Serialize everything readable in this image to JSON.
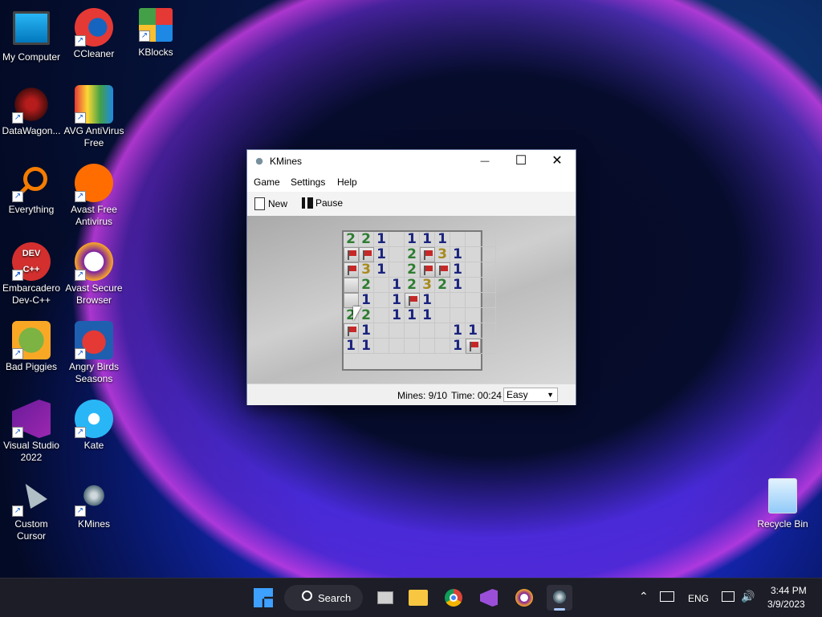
{
  "desktop": {
    "icons": [
      {
        "label": "My Computer"
      },
      {
        "label": "CCleaner"
      },
      {
        "label": "KBlocks"
      },
      {
        "label": "DataWagon..."
      },
      {
        "label": "AVG AntiVirus Free"
      },
      {
        "label": "Everything"
      },
      {
        "label": "Avast Free Antivirus"
      },
      {
        "label": "Embarcadero Dev-C++"
      },
      {
        "label": "Avast Secure Browser"
      },
      {
        "label": "Bad Piggies"
      },
      {
        "label": "Angry Birds Seasons"
      },
      {
        "label": "Visual Studio 2022"
      },
      {
        "label": "Kate"
      },
      {
        "label": "Custom Cursor"
      },
      {
        "label": "KMines"
      },
      {
        "label": "Recycle Bin"
      }
    ]
  },
  "window": {
    "title": "KMines",
    "controls": {
      "minimize": "—",
      "maximize": "☐",
      "close": "✕"
    },
    "menu": [
      "Game",
      "Settings",
      "Help"
    ],
    "toolbar": {
      "new_label": "New",
      "pause_label": "Pause"
    },
    "board": {
      "rows": [
        [
          "2",
          "2",
          "1",
          "",
          "1",
          "1",
          "1",
          "",
          "",
          ""
        ],
        [
          "F",
          "F",
          "1",
          "",
          "2",
          "F",
          "3",
          "1",
          "",
          ""
        ],
        [
          "F",
          "3",
          "1",
          "",
          "2",
          "F",
          "F",
          "1",
          "",
          ""
        ],
        [
          "C",
          "2",
          "",
          "1",
          "2",
          "3",
          "2",
          "1",
          "",
          ""
        ],
        [
          "C",
          "1",
          "",
          "1",
          "F",
          "1",
          "",
          "",
          "",
          ""
        ],
        [
          "2",
          "2",
          "",
          "1",
          "1",
          "1",
          "",
          "",
          "",
          ""
        ],
        [
          "F",
          "1",
          "",
          "",
          "",
          "",
          "",
          "1",
          "1",
          ""
        ],
        [
          "1",
          "1",
          "",
          "",
          "",
          "",
          "",
          "1",
          "F",
          ""
        ]
      ]
    },
    "status": {
      "mines": "Mines: 9/10",
      "time": "Time: 00:24",
      "difficulty": "Easy"
    }
  },
  "taskbar": {
    "search_label": "Search",
    "language": "ENG",
    "time": "3:44 PM",
    "date": "3/9/2023"
  }
}
